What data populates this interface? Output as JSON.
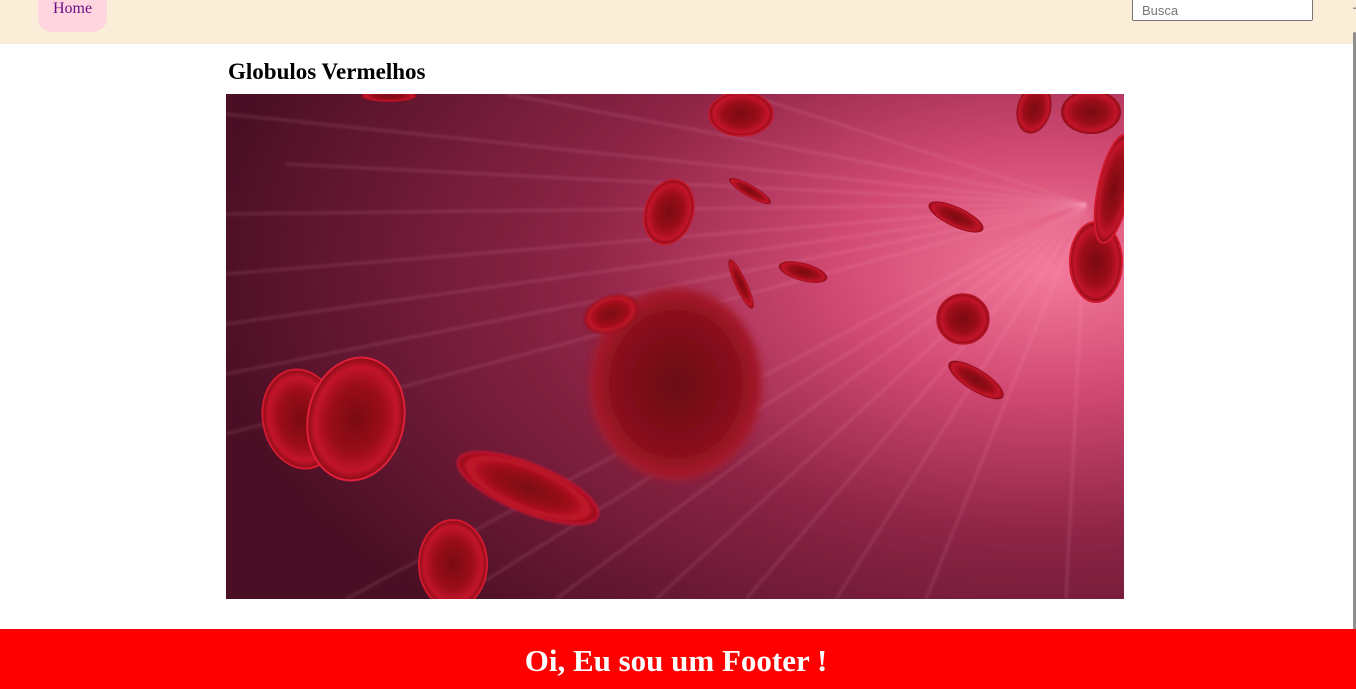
{
  "nav": {
    "home_label": "Home",
    "search_placeholder": "Busca",
    "search_value": ""
  },
  "main": {
    "title": "Globulos Vermelhos",
    "image_icon": "red-blood-cells-image"
  },
  "footer": {
    "text": "Oi, Eu sou um Footer !"
  },
  "colors": {
    "navbar_bg": "#faeed9",
    "home_tab_bg": "#ffd6df",
    "home_link": "#6a0d86",
    "footer_bg": "#ff0000",
    "footer_text": "#ffffff"
  }
}
